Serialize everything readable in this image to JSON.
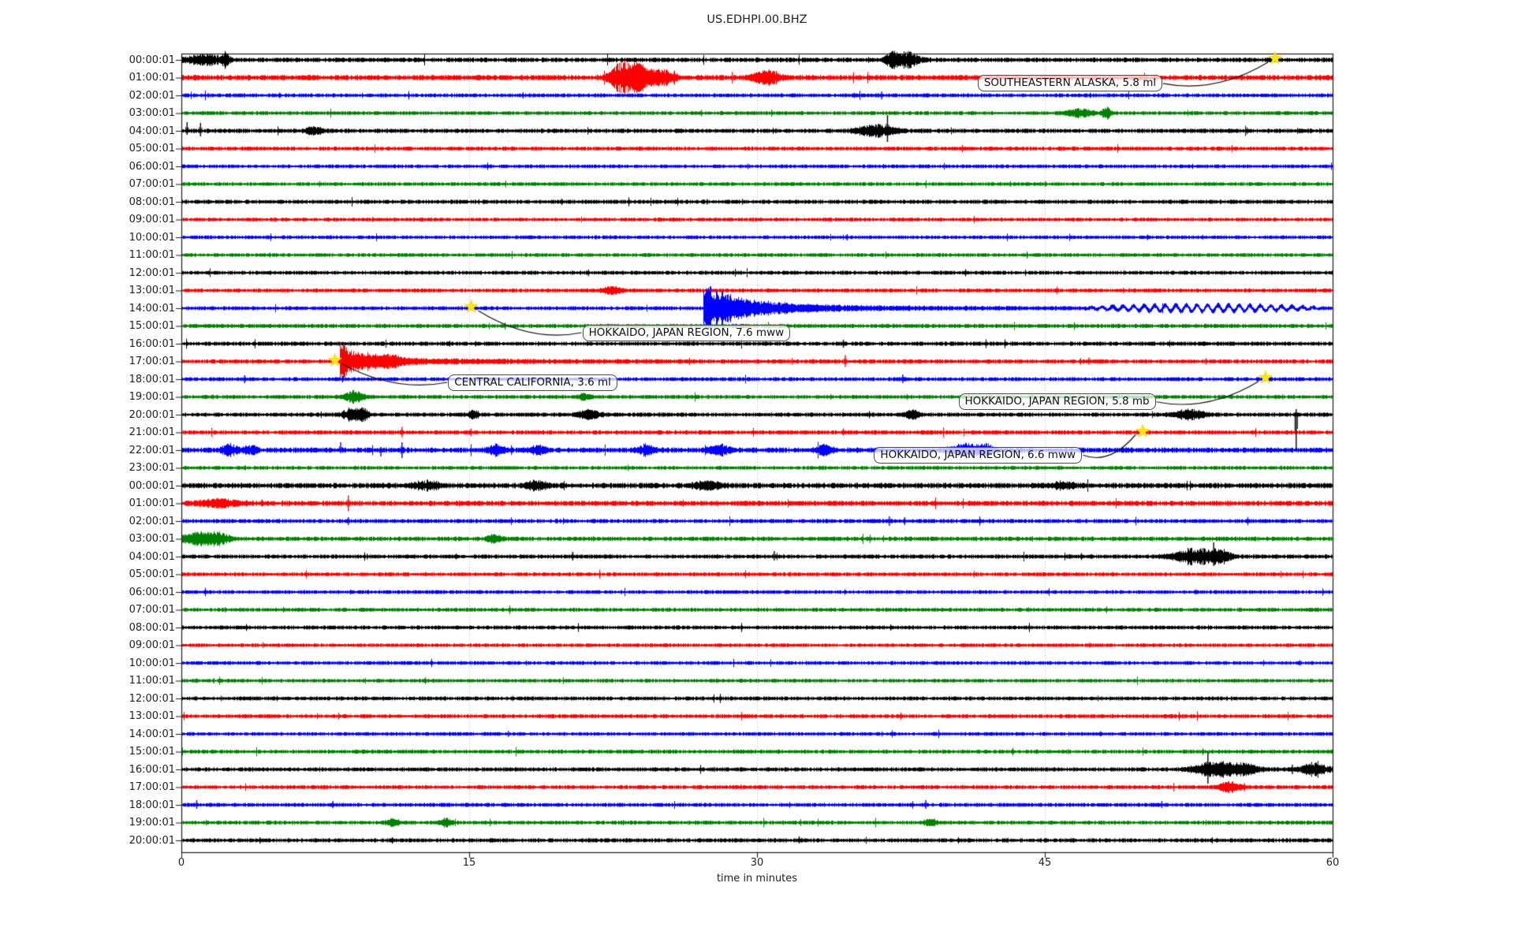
{
  "chart_data": {
    "type": "line",
    "title": "US.EDHPI.00.BHZ",
    "xlabel": "time in minutes",
    "xlim": [
      0,
      60
    ],
    "x_ticks": [
      "0",
      "15",
      "30",
      "45",
      "60"
    ],
    "x_tick_minutes": [
      0,
      15,
      30,
      45,
      60
    ],
    "grid_minutes": [
      15,
      30,
      45
    ],
    "grid_style": "dotted",
    "trace_cycle_colors": [
      "#000000",
      "#ff0000",
      "#0000ff",
      "#008000"
    ],
    "event_marker_color": "#ffe600",
    "rows": [
      {
        "label": "00:00:01",
        "color": "#000000",
        "noise": 2.1,
        "bursts": [
          {
            "t": 1.2,
            "w": 0.7,
            "a": 5
          },
          {
            "t": 2.3,
            "w": 0.12,
            "a": 8
          },
          {
            "t": 37.0,
            "w": 0.25,
            "a": 7
          },
          {
            "t": 37.8,
            "w": 0.45,
            "a": 8
          }
        ]
      },
      {
        "label": "01:00:01",
        "color": "#ff0000",
        "noise": 2.4,
        "bursts": [
          {
            "t": 23.0,
            "w": 0.45,
            "a": 16
          },
          {
            "t": 23.9,
            "w": 0.35,
            "a": 13
          },
          {
            "t": 25.0,
            "w": 0.45,
            "a": 8
          },
          {
            "t": 30.5,
            "w": 0.5,
            "a": 7
          }
        ],
        "spikes": [
          {
            "t": 25.7,
            "up": 9,
            "dn": 9
          }
        ]
      },
      {
        "label": "02:00:01",
        "color": "#0000ff",
        "noise": 1.8,
        "spikes": [
          {
            "t": 36.5,
            "up": 5,
            "dn": 5
          }
        ]
      },
      {
        "label": "03:00:01",
        "color": "#008000",
        "noise": 1.8,
        "bursts": [
          {
            "t": 46.8,
            "w": 0.5,
            "a": 4
          },
          {
            "t": 48.2,
            "w": 0.15,
            "a": 6
          }
        ]
      },
      {
        "label": "04:00:01",
        "color": "#000000",
        "noise": 2.0,
        "bursts": [
          {
            "t": 6.9,
            "w": 0.3,
            "a": 4
          },
          {
            "t": 36.2,
            "w": 0.7,
            "a": 6
          }
        ],
        "spikes": [
          {
            "t": 0.3,
            "up": 11,
            "dn": 5
          },
          {
            "t": 1.0,
            "up": 10,
            "dn": 7
          },
          {
            "t": 36.8,
            "up": 20,
            "dn": 14
          }
        ]
      },
      {
        "label": "05:00:01",
        "color": "#ff0000",
        "noise": 1.8
      },
      {
        "label": "06:00:01",
        "color": "#0000ff",
        "noise": 1.7
      },
      {
        "label": "07:00:01",
        "color": "#008000",
        "noise": 1.7
      },
      {
        "label": "08:00:01",
        "color": "#000000",
        "noise": 1.9
      },
      {
        "label": "09:00:01",
        "color": "#ff0000",
        "noise": 1.7
      },
      {
        "label": "10:00:01",
        "color": "#0000ff",
        "noise": 1.7,
        "spikes": [
          {
            "t": 34.7,
            "up": 4,
            "dn": 4
          }
        ]
      },
      {
        "label": "11:00:01",
        "color": "#008000",
        "noise": 1.7
      },
      {
        "label": "12:00:01",
        "color": "#000000",
        "noise": 1.8
      },
      {
        "label": "13:00:01",
        "color": "#ff0000",
        "noise": 1.8,
        "bursts": [
          {
            "t": 22.4,
            "w": 0.35,
            "a": 4
          }
        ]
      },
      {
        "label": "14:00:01",
        "color": "#0000ff",
        "noise": 1.8,
        "quake": {
          "t": 27.2,
          "a": 26,
          "decay": 2.0
        },
        "sine": {
          "t0": 47.0,
          "t1": 59.5,
          "a": 4,
          "period": 0.55
        }
      },
      {
        "label": "15:00:01",
        "color": "#008000",
        "noise": 1.9
      },
      {
        "label": "16:00:01",
        "color": "#000000",
        "noise": 1.9,
        "spikes": [
          {
            "t": 34.5,
            "up": 5,
            "dn": 5
          }
        ]
      },
      {
        "label": "17:00:01",
        "color": "#ff0000",
        "noise": 1.9,
        "quake": {
          "t": 8.25,
          "a": 20,
          "decay": 1.1
        },
        "bursts": [
          {
            "t": 10.8,
            "w": 0.5,
            "a": 4
          }
        ],
        "spikes": [
          {
            "t": 34.6,
            "up": 8,
            "dn": 7
          },
          {
            "t": 47.3,
            "up": 5,
            "dn": 4
          },
          {
            "t": 53.4,
            "up": 4,
            "dn": 4
          }
        ]
      },
      {
        "label": "18:00:01",
        "color": "#0000ff",
        "noise": 1.8,
        "spikes": [
          {
            "t": 3.3,
            "up": 5,
            "dn": 5
          },
          {
            "t": 8.4,
            "up": 4,
            "dn": 4
          },
          {
            "t": 37.6,
            "up": 6,
            "dn": 5
          }
        ]
      },
      {
        "label": "19:00:01",
        "color": "#008000",
        "noise": 1.8,
        "bursts": [
          {
            "t": 9.0,
            "w": 0.35,
            "a": 6
          },
          {
            "t": 21.0,
            "w": 0.25,
            "a": 3
          }
        ]
      },
      {
        "label": "20:00:01",
        "color": "#000000",
        "noise": 1.9,
        "bursts": [
          {
            "t": 8.9,
            "w": 0.35,
            "a": 6
          },
          {
            "t": 9.5,
            "w": 0.2,
            "a": 5
          },
          {
            "t": 15.2,
            "w": 0.2,
            "a": 4
          },
          {
            "t": 21.2,
            "w": 0.4,
            "a": 5
          },
          {
            "t": 38.1,
            "w": 0.3,
            "a": 4
          },
          {
            "t": 52.5,
            "w": 0.6,
            "a": 5
          }
        ],
        "spikes": [
          {
            "t": 58.1,
            "up": 7,
            "dn": 45
          }
        ]
      },
      {
        "label": "21:00:01",
        "color": "#ff0000",
        "noise": 1.9,
        "spikes": [
          {
            "t": 11.5,
            "up": 7,
            "dn": 6
          },
          {
            "t": 15.1,
            "up": 5,
            "dn": 5
          },
          {
            "t": 34.5,
            "up": 5,
            "dn": 4
          }
        ]
      },
      {
        "label": "22:00:01",
        "color": "#0000ff",
        "noise": 2.4,
        "bursts": [
          {
            "t": 2.5,
            "w": 0.3,
            "a": 5
          },
          {
            "t": 3.6,
            "w": 0.25,
            "a": 4
          },
          {
            "t": 16.4,
            "w": 0.3,
            "a": 5
          },
          {
            "t": 18.6,
            "w": 0.3,
            "a": 4
          },
          {
            "t": 24.2,
            "w": 0.3,
            "a": 5
          },
          {
            "t": 28.0,
            "w": 0.4,
            "a": 5
          },
          {
            "t": 33.5,
            "w": 0.3,
            "a": 5
          },
          {
            "t": 40.8,
            "w": 0.5,
            "a": 6
          },
          {
            "t": 41.9,
            "w": 0.3,
            "a": 5
          }
        ],
        "spikes": [
          {
            "t": 8.3,
            "up": 10,
            "dn": 4
          },
          {
            "t": 10.4,
            "up": 4,
            "dn": 8
          },
          {
            "t": 11.5,
            "up": 10,
            "dn": 10
          }
        ]
      },
      {
        "label": "23:00:01",
        "color": "#008000",
        "noise": 1.7
      },
      {
        "label": "00:00:01",
        "color": "#000000",
        "noise": 2.5,
        "bursts": [
          {
            "t": 12.7,
            "w": 0.5,
            "a": 4
          },
          {
            "t": 18.5,
            "w": 0.4,
            "a": 4
          },
          {
            "t": 27.4,
            "w": 0.5,
            "a": 4
          },
          {
            "t": 45.9,
            "w": 0.4,
            "a": 3
          }
        ]
      },
      {
        "label": "01:00:01",
        "color": "#ff0000",
        "noise": 2.3,
        "bursts": [
          {
            "t": 2.0,
            "w": 0.8,
            "a": 4
          }
        ],
        "spikes": [
          {
            "t": 4.2,
            "up": 5,
            "dn": 4
          },
          {
            "t": 8.7,
            "up": 10,
            "dn": 10
          }
        ]
      },
      {
        "label": "02:00:01",
        "color": "#0000ff",
        "noise": 1.9,
        "spikes": [
          {
            "t": 8.7,
            "up": 5,
            "dn": 5
          },
          {
            "t": 36.9,
            "up": 6,
            "dn": 6
          },
          {
            "t": 37.7,
            "up": 5,
            "dn": 5
          }
        ]
      },
      {
        "label": "03:00:01",
        "color": "#008000",
        "noise": 2.0,
        "bursts": [
          {
            "t": 0.8,
            "w": 0.7,
            "a": 6
          },
          {
            "t": 2.0,
            "w": 0.4,
            "a": 5
          },
          {
            "t": 16.3,
            "w": 0.3,
            "a": 4
          }
        ]
      },
      {
        "label": "04:00:01",
        "color": "#000000",
        "noise": 1.9,
        "bursts": [
          {
            "t": 52.8,
            "w": 0.8,
            "a": 8
          },
          {
            "t": 54.2,
            "w": 0.4,
            "a": 6
          }
        ],
        "spikes": [
          {
            "t": 20.4,
            "up": 6,
            "dn": 5
          },
          {
            "t": 30.9,
            "up": 7,
            "dn": 5
          },
          {
            "t": 53.8,
            "up": 18,
            "dn": 12
          }
        ]
      },
      {
        "label": "05:00:01",
        "color": "#ff0000",
        "noise": 1.8
      },
      {
        "label": "06:00:01",
        "color": "#0000ff",
        "noise": 1.7
      },
      {
        "label": "07:00:01",
        "color": "#008000",
        "noise": 1.8
      },
      {
        "label": "08:00:01",
        "color": "#000000",
        "noise": 1.8
      },
      {
        "label": "09:00:01",
        "color": "#ff0000",
        "noise": 1.7
      },
      {
        "label": "10:00:01",
        "color": "#0000ff",
        "noise": 1.7
      },
      {
        "label": "11:00:01",
        "color": "#008000",
        "noise": 1.7
      },
      {
        "label": "12:00:01",
        "color": "#000000",
        "noise": 1.8
      },
      {
        "label": "13:00:01",
        "color": "#ff0000",
        "noise": 1.8
      },
      {
        "label": "14:00:01",
        "color": "#0000ff",
        "noise": 1.7
      },
      {
        "label": "15:00:01",
        "color": "#008000",
        "noise": 1.8
      },
      {
        "label": "16:00:01",
        "color": "#000000",
        "noise": 1.9,
        "bursts": [
          {
            "t": 53.9,
            "w": 0.8,
            "a": 8
          },
          {
            "t": 55.4,
            "w": 0.5,
            "a": 5
          },
          {
            "t": 59.0,
            "w": 0.5,
            "a": 6
          }
        ],
        "spikes": [
          {
            "t": 53.5,
            "up": 22,
            "dn": 18
          },
          {
            "t": 57.9,
            "up": 6,
            "dn": 6
          }
        ]
      },
      {
        "label": "17:00:01",
        "color": "#ff0000",
        "noise": 1.8,
        "bursts": [
          {
            "t": 54.6,
            "w": 0.4,
            "a": 5
          }
        ],
        "spikes": [
          {
            "t": 55.4,
            "up": 5,
            "dn": 5
          }
        ]
      },
      {
        "label": "18:00:01",
        "color": "#0000ff",
        "noise": 1.8,
        "spikes": [
          {
            "t": 0.8,
            "up": 6,
            "dn": 5
          },
          {
            "t": 7.9,
            "up": 5,
            "dn": 4
          },
          {
            "t": 38.8,
            "up": 6,
            "dn": 5
          },
          {
            "t": 51.1,
            "up": 5,
            "dn": 4
          }
        ]
      },
      {
        "label": "19:00:01",
        "color": "#008000",
        "noise": 1.8,
        "bursts": [
          {
            "t": 11.0,
            "w": 0.2,
            "a": 5
          },
          {
            "t": 13.8,
            "w": 0.2,
            "a": 4
          },
          {
            "t": 39.0,
            "w": 0.2,
            "a": 4
          }
        ]
      },
      {
        "label": "20:00:01",
        "color": "#000000",
        "noise": 1.9,
        "spikes": [
          {
            "t": 4.1,
            "up": 4,
            "dn": 4
          },
          {
            "t": 11.0,
            "up": 4,
            "dn": 4
          },
          {
            "t": 32.2,
            "up": 5,
            "dn": 4
          }
        ]
      }
    ],
    "annotations": [
      {
        "label": "SOUTHEASTERN ALASKA, 5.8 ml",
        "star_row": 0,
        "star_min": 57.0,
        "box_min": 41.5,
        "box_row": 1.35,
        "attach": "right"
      },
      {
        "label": "HOKKAIDO, JAPAN REGION, 7.6 mww",
        "star_row": 14,
        "star_min": 15.1,
        "box_min": 20.9,
        "box_row": 15.4,
        "attach": "left"
      },
      {
        "label": "CENTRAL CALIFORNIA, 3.6 ml",
        "star_row": 17,
        "star_min": 8.0,
        "box_min": 13.9,
        "box_row": 18.2,
        "attach": "left"
      },
      {
        "label": "HOKKAIDO, JAPAN REGION, 5.8 mb",
        "star_row": 18,
        "star_min": 56.5,
        "box_min": 40.5,
        "box_row": 19.3,
        "attach": "right"
      },
      {
        "label": "HOKKAIDO, JAPAN REGION, 6.6 mww",
        "star_row": 21,
        "star_min": 50.1,
        "box_min": 36.1,
        "box_row": 22.3,
        "attach": "right"
      }
    ]
  }
}
